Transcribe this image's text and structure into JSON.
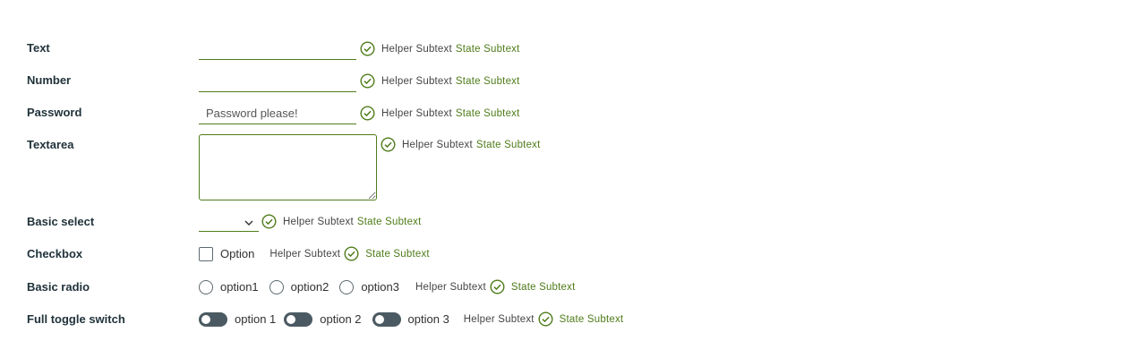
{
  "colors": {
    "success": "#4f7c1a",
    "label": "#21333b",
    "toggle_track": "#4b5a62"
  },
  "rows": {
    "text": {
      "label": "Text",
      "value": "",
      "helper": "Helper Subtext",
      "state": "State Subtext"
    },
    "number": {
      "label": "Number",
      "value": "",
      "helper": "Helper Subtext",
      "state": "State Subtext"
    },
    "password": {
      "label": "Password",
      "placeholder": "Password please!",
      "helper": "Helper Subtext",
      "state": "State Subtext"
    },
    "textarea": {
      "label": "Textarea",
      "value": "",
      "helper": "Helper Subtext",
      "state": "State Subtext"
    },
    "select": {
      "label": "Basic select",
      "selected": "",
      "helper": "Helper Subtext",
      "state": "State Subtext"
    },
    "checkbox": {
      "label": "Checkbox",
      "option": "Option",
      "checked": false,
      "helper": "Helper Subtext",
      "state": "State Subtext"
    },
    "radio": {
      "label": "Basic radio",
      "options": [
        "option1",
        "option2",
        "option3"
      ],
      "helper": "Helper Subtext",
      "state": "State Subtext"
    },
    "toggle": {
      "label": "Full toggle switch",
      "options": [
        "option 1",
        "option 2",
        "option 3"
      ],
      "helper": "Helper Subtext",
      "state": "State Subtext"
    }
  },
  "icons": {
    "status": "check-circle-icon",
    "select_arrow": "chevron-down-icon"
  }
}
